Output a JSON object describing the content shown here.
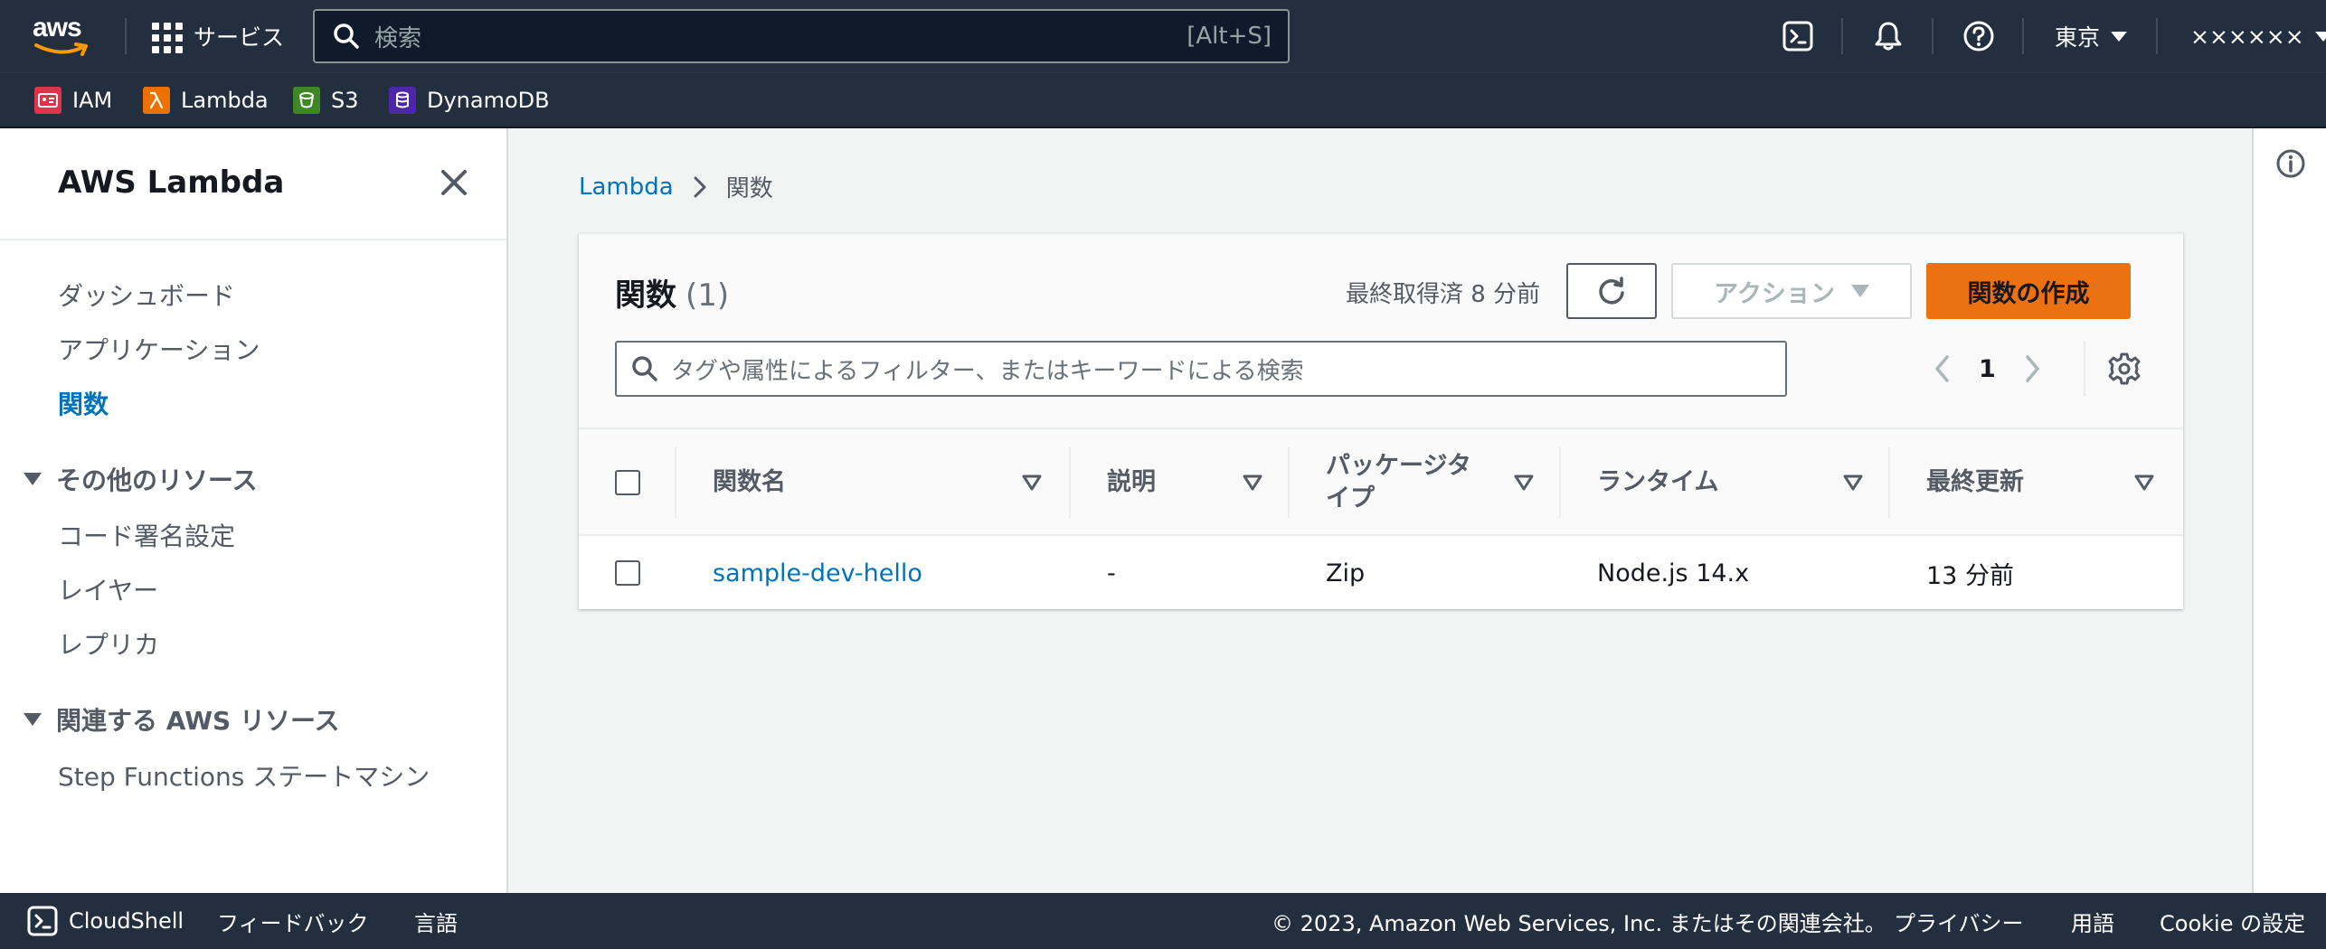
{
  "topnav": {
    "logo_text": "aws",
    "services_label": "サービス",
    "search_placeholder": "検索",
    "search_shortcut": "[Alt+S]",
    "region": "東京",
    "account": "××××××"
  },
  "favorites": [
    {
      "label": "IAM",
      "color": "#dd344c",
      "icon": "iam-icon"
    },
    {
      "label": "Lambda",
      "color": "#ed7100",
      "icon": "lambda-icon"
    },
    {
      "label": "S3",
      "color": "#3f8624",
      "icon": "s3-icon"
    },
    {
      "label": "DynamoDB",
      "color": "#4d27aa",
      "icon": "dynamodb-icon"
    }
  ],
  "sidenav": {
    "title": "AWS Lambda",
    "items": [
      {
        "label": "ダッシュボード"
      },
      {
        "label": "アプリケーション"
      },
      {
        "label": "関数",
        "active": true
      }
    ],
    "section_other": {
      "label": "その他のリソース",
      "items": [
        {
          "label": "コード署名設定"
        },
        {
          "label": "レイヤー"
        },
        {
          "label": "レプリカ"
        }
      ]
    },
    "section_related": {
      "label": "関連する AWS リソース",
      "items": [
        {
          "label": "Step Functions ステートマシン"
        }
      ]
    }
  },
  "breadcrumb": {
    "root": "Lambda",
    "current": "関数"
  },
  "functions_panel": {
    "title": "関数",
    "count": "(1)",
    "last_fetched": "最終取得済 8 分前",
    "actions_label": "アクション",
    "create_label": "関数の作成",
    "filter_placeholder": "タグや属性によるフィルター、またはキーワードによる検索",
    "page": "1",
    "columns": {
      "name": "関数名",
      "description": "説明",
      "package_type_1": "パッケージタ",
      "package_type_2": "イプ",
      "runtime": "ランタイム",
      "last_modified": "最終更新"
    },
    "rows": [
      {
        "name": "sample-dev-hello",
        "description": "-",
        "package_type": "Zip",
        "runtime": "Node.js 14.x",
        "last_modified": "13 分前"
      }
    ]
  },
  "footer": {
    "cloudshell": "CloudShell",
    "feedback": "フィードバック",
    "language": "言語",
    "copyright": "© 2023, Amazon Web Services, Inc. またはその関連会社。",
    "privacy": "プライバシー",
    "terms": "用語",
    "cookie": "Cookie の設定"
  },
  "colors": {
    "nav_bg": "#232f3e",
    "link": "#0073bb",
    "primary_button": "#ec7211",
    "page_bg": "#f2f3f3"
  }
}
